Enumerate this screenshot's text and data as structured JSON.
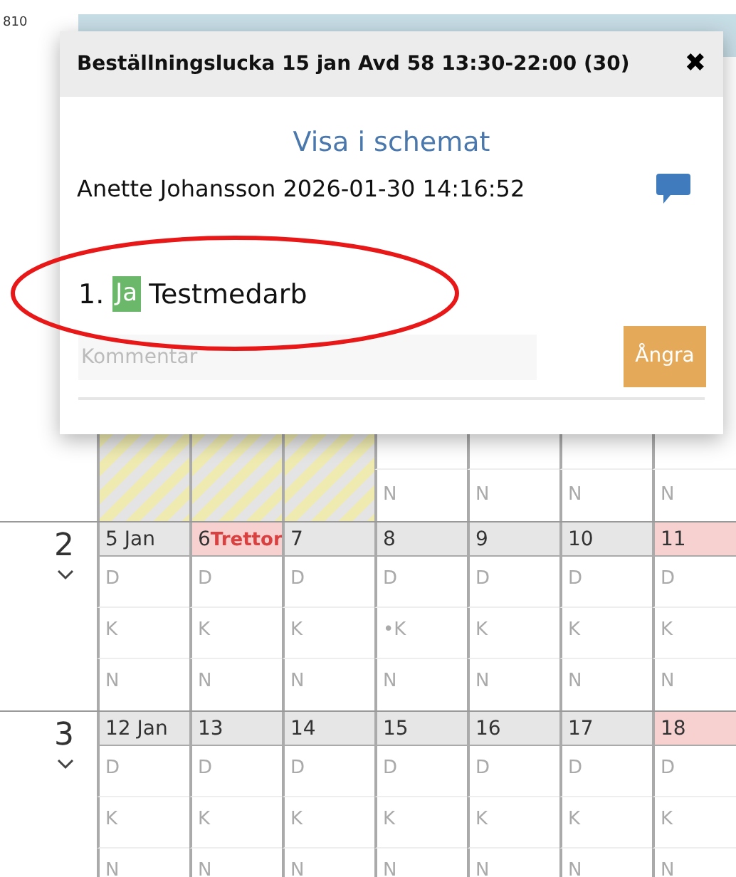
{
  "corner_label": "810",
  "partial_week": {
    "cells": [
      {
        "kind": "hatched"
      },
      {
        "kind": "hatched"
      },
      {
        "kind": "hatched"
      },
      {
        "kind": "shift",
        "label": "N"
      },
      {
        "kind": "shift",
        "label": "N"
      },
      {
        "kind": "shift",
        "label": "N"
      },
      {
        "kind": "shift",
        "label": "N"
      }
    ]
  },
  "weeks": [
    {
      "number": "2",
      "days": [
        {
          "label": "5 Jan",
          "red_day": false
        },
        {
          "label": "6",
          "note": "Trettor",
          "red_day": true
        },
        {
          "label": "7",
          "red_day": false
        },
        {
          "label": "8",
          "red_day": false
        },
        {
          "label": "9",
          "red_day": false
        },
        {
          "label": "10",
          "red_day": false
        },
        {
          "label": "11",
          "red_day": true
        }
      ],
      "shift_rows": [
        [
          "D",
          "D",
          "D",
          "D",
          "D",
          "D",
          "D"
        ],
        [
          "K",
          "K",
          "K",
          "•K",
          "K",
          "K",
          "K"
        ],
        [
          "N",
          "N",
          "N",
          "N",
          "N",
          "N",
          "N"
        ]
      ]
    },
    {
      "number": "3",
      "days": [
        {
          "label": "12 Jan",
          "red_day": false
        },
        {
          "label": "13",
          "red_day": false
        },
        {
          "label": "14",
          "red_day": false
        },
        {
          "label": "15",
          "red_day": false
        },
        {
          "label": "16",
          "red_day": false
        },
        {
          "label": "17",
          "red_day": false
        },
        {
          "label": "18",
          "red_day": true
        }
      ],
      "shift_rows": [
        [
          "D",
          "D",
          "D",
          "D",
          "D",
          "D",
          "D"
        ],
        [
          "K",
          "K",
          "K",
          "K",
          "K",
          "K",
          "K"
        ],
        [
          "N",
          "N",
          "N",
          "N",
          "N",
          "N",
          "N"
        ]
      ]
    }
  ],
  "dialog": {
    "title": "Beställningslucka 15 jan Avd 58 13:30-22:00 (30)",
    "close": "✖",
    "link": "Visa i schemat",
    "author_line": "Anette Johansson 2026-01-30 14:16:52",
    "entries": [
      {
        "index": "1.",
        "badge": "Ja",
        "name": "Testmedarb",
        "highlighted": true
      }
    ],
    "comment": {
      "placeholder": "Kommentar"
    },
    "undo_button": "Ångra"
  }
}
